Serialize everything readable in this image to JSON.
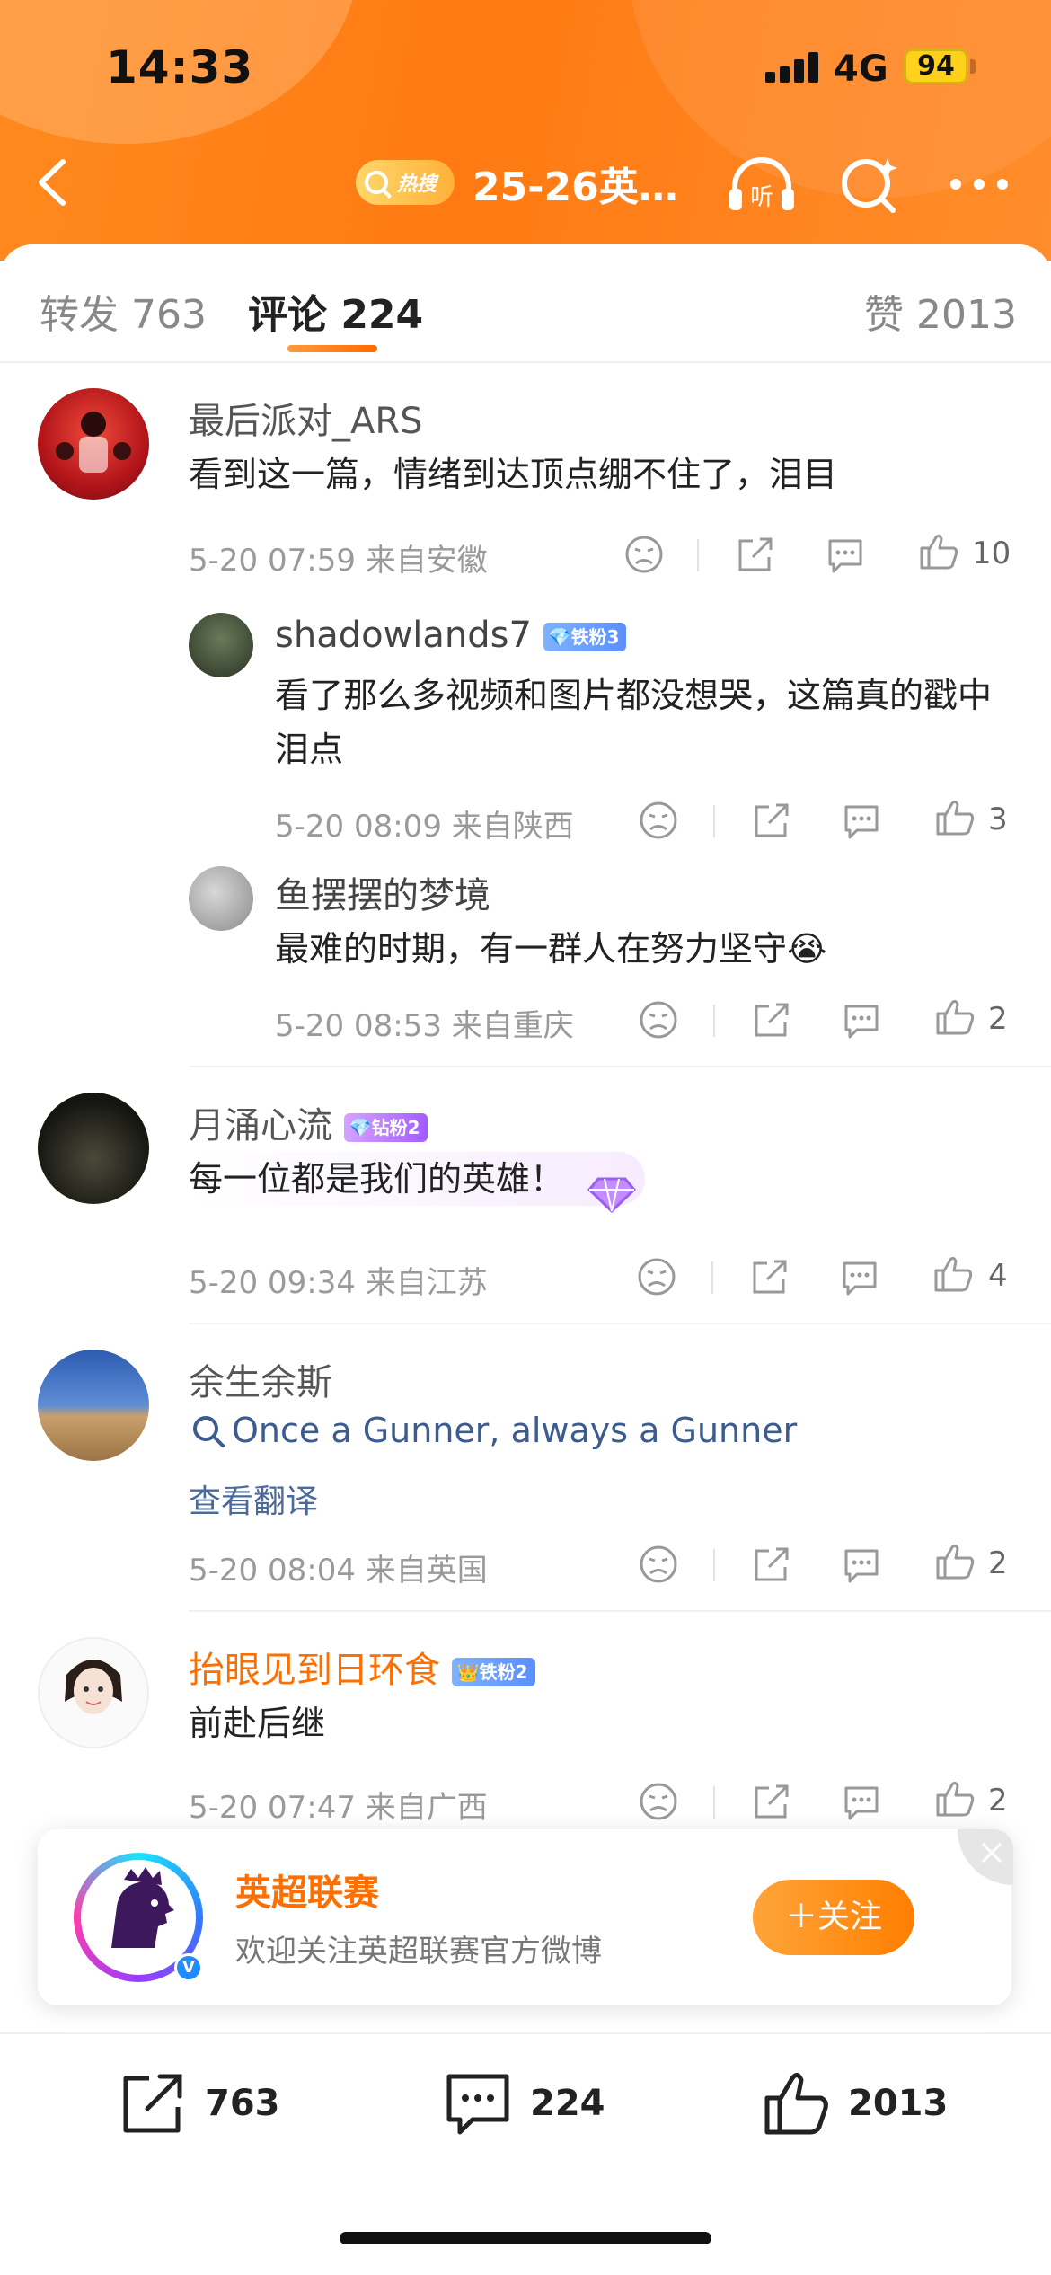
{
  "status_bar": {
    "time": "14:33",
    "network": "4G",
    "battery": "94"
  },
  "nav": {
    "hot_label": "热搜",
    "title": "25-26英…",
    "listen_label": "听"
  },
  "tabs": {
    "repost": "转发 763",
    "comments": "评论 224",
    "likes": "赞 2013"
  },
  "comments": [
    {
      "user": "最后派对_ARS",
      "text": "看到这一篇，情绪到达顶点绷不住了，泪目",
      "meta": "5-20 07:59  来自安徽",
      "likes": "10",
      "replies": [
        {
          "user": "shadowlands7",
          "badge": "铁粉3",
          "text_line1": "看了那么多视频和图片都没想哭，这篇真的戳中",
          "text_line2": "泪点",
          "meta": "5-20 08:09  来自陕西",
          "likes": "3"
        },
        {
          "user": "鱼摆摆的梦境",
          "text": "最难的时期，有一群人在努力坚守😭",
          "meta": "5-20 08:53  来自重庆",
          "likes": "2"
        }
      ]
    },
    {
      "user": "月涌心流",
      "badge": "钻粉2",
      "text": "每一位都是我们的英雄！",
      "meta": "5-20 09:34  来自江苏",
      "likes": "4"
    },
    {
      "user": "余生余斯",
      "text": "Once a Gunner, always a Gunner",
      "translate": "查看翻译",
      "meta": "5-20 08:04  来自英国",
      "likes": "2"
    },
    {
      "user": "抬眼见到日环食",
      "badge": "铁粉2",
      "text": "前赴后继",
      "meta": "5-20 07:47  来自广西",
      "likes": "2"
    }
  ],
  "follow_card": {
    "name": "英超联赛",
    "desc": "欢迎关注英超联赛官方微博",
    "button": "＋关注"
  },
  "bottom_bar": {
    "reposts": "763",
    "comments": "224",
    "likes": "2013"
  },
  "colors": {
    "header": "#ff7a12",
    "accent": "#ff7f00",
    "link": "#3c5b8e"
  }
}
